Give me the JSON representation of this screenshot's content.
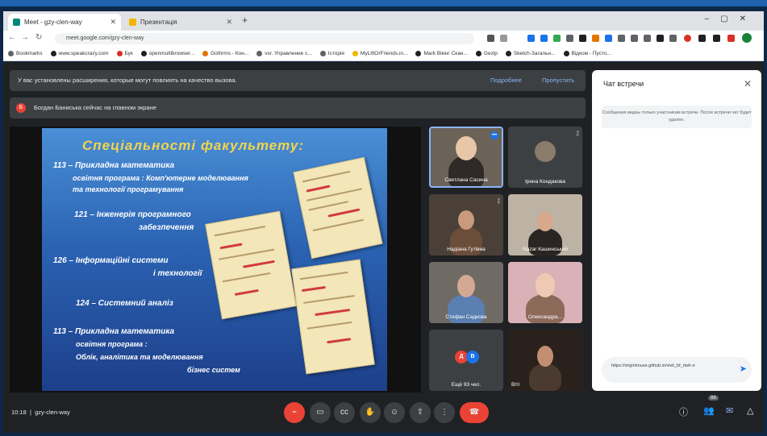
{
  "browser": {
    "tabs": [
      {
        "title": "Meet - gzy-clen-way",
        "active": true
      },
      {
        "title": "Презентація",
        "active": false
      }
    ],
    "new_tab": "+",
    "url": "meet.google.com/gzy-clen-way",
    "bookmarks": [
      "Bookmarks",
      "www.speakcrazy.com",
      "Бук",
      "openmultibrowser...",
      "Gothrms - Кон...",
      "vsr. Управление с...",
      "Історія",
      "MyLiftOrFriends.in...",
      "Маrk Вікінг Скан...",
      "Gezip",
      "Sketch-Загальн...",
      "Відком - Пусто..."
    ],
    "window_controls": [
      "–",
      "▢",
      "✕"
    ]
  },
  "meet": {
    "banner_text": "У вас установлены расширения, которые могут повлиять на качество вызова.",
    "banner_actions": [
      "Подробнее",
      "Пропустить"
    ],
    "presenting_text": "Богдан Баниська сейчас на главном экране",
    "presenter_initial": "Б",
    "slide": {
      "title": "Спеціальності факультету:",
      "lines": [
        "113 – Прикладна математика",
        "освітня програма : Комп'ютерне моделювання",
        "та технології програмування",
        "121 – Інженерія програмного",
        "забезпечення",
        "126 – Інформаційні системи",
        "і технології",
        "124 – Системний аналіз",
        "113 – Прикладна математика",
        "освітня програма :",
        "Облік, аналітика та моделювання",
        "бізнес систем"
      ]
    },
    "participants": [
      {
        "name": "Светлана Сасина"
      },
      {
        "name": "Ірина Кондакова"
      },
      {
        "name": "Надіана Гутівна"
      },
      {
        "name": "Nazar Кашинський"
      },
      {
        "name": "Стефан Садкова"
      },
      {
        "name": "Олександра..."
      },
      {
        "name": "Ещё 93 чел."
      },
      {
        "name": "Віті"
      }
    ],
    "more_badges": [
      "Д",
      "В"
    ],
    "chat": {
      "title": "Чат встречи",
      "info": "Сообщения видны только участникам встречи. После встречи чат будет удален.",
      "message": "https://virginhouse.github.io/vivit_bf_rtwh e"
    },
    "bottom": {
      "time": "10:18",
      "meeting_code": "gzy-clen-way",
      "participant_count": "99"
    }
  }
}
